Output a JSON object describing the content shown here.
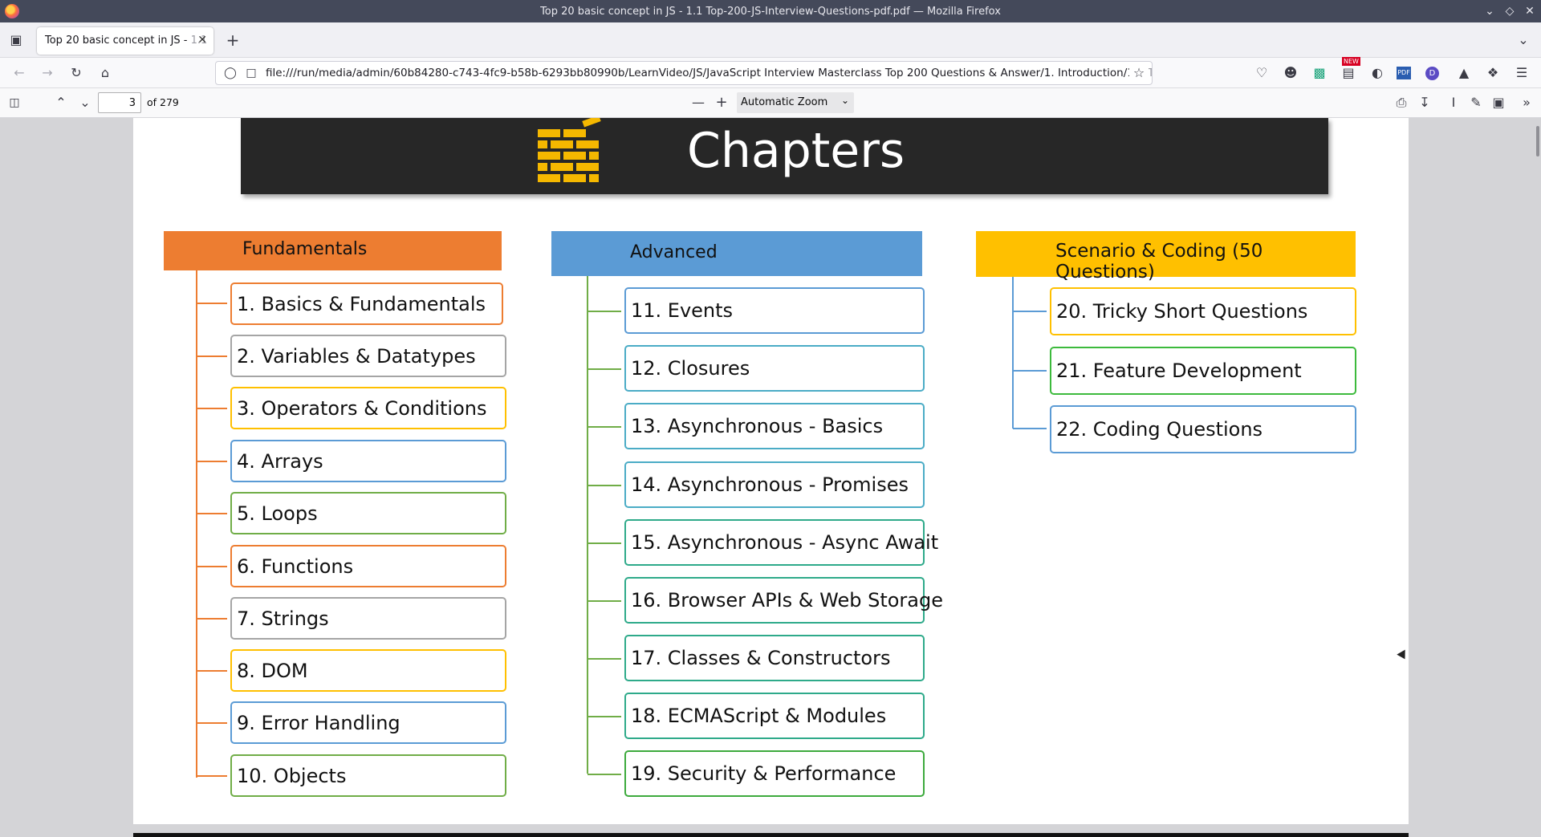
{
  "window": {
    "title": "Top 20 basic concept in JS - 1.1 Top-200-JS-Interview-Questions-pdf.pdf — Mozilla Firefox"
  },
  "tabs": [
    {
      "label": "Top 20 basic concept in JS - ",
      "label_fade": "1.1"
    }
  ],
  "nav": {
    "url": "file:///run/media/admin/60b84280-c743-4fc9-b58b-6293bb80990b/LearnVideo/JS/JavaScript Interview Masterclass Top 200 Questions & Answer/1. Introduction/1.1 ",
    "url_fade": "T"
  },
  "pdf_toolbar": {
    "page_number": "3",
    "page_count": "of 279",
    "zoom": "Automatic Zoom",
    "badge_new": "NEW",
    "badge_pdf": "PDF",
    "badge_d": "D"
  },
  "document": {
    "banner_title": "Chapters",
    "columns": [
      {
        "header": "Fundamentals",
        "header_color": "#ED7D31",
        "items": [
          {
            "label": "1. Basics & Fundamentals",
            "color": "#ED7D31"
          },
          {
            "label": "2. Variables & Datatypes",
            "color": "#A5A5A5"
          },
          {
            "label": "3. Operators & Conditions",
            "color": "#FFC000"
          },
          {
            "label": "4. Arrays",
            "color": "#5B9BD5"
          },
          {
            "label": "5. Loops",
            "color": "#70AD47"
          },
          {
            "label": "6. Functions",
            "color": "#ED7D31"
          },
          {
            "label": "7. Strings",
            "color": "#A5A5A5"
          },
          {
            "label": "8. DOM",
            "color": "#FFC000"
          },
          {
            "label": "9. Error Handling",
            "color": "#5B9BD5"
          },
          {
            "label": "10. Objects",
            "color": "#70AD47"
          }
        ]
      },
      {
        "header": "Advanced",
        "header_color": "#5B9BD5",
        "items": [
          {
            "label": "11. Events",
            "color": "#5B9BD5"
          },
          {
            "label": "12. Closures",
            "color": "#4BACC6"
          },
          {
            "label": "13. Asynchronous - Basics",
            "color": "#4BACC6"
          },
          {
            "label": "14. Asynchronous - Promises",
            "color": "#4BACC6"
          },
          {
            "label": "15. Asynchronous - Async Await",
            "color": "#2EAA8A"
          },
          {
            "label": "16. Browser APIs & Web Storage",
            "color": "#2EAA8A"
          },
          {
            "label": "17. Classes & Constructors",
            "color": "#2EAA8A"
          },
          {
            "label": "18. ECMAScript & Modules",
            "color": "#2EAA8A"
          },
          {
            "label": "19. Security & Performance",
            "color": "#3DAA3D"
          }
        ]
      },
      {
        "header": "Scenario & Coding (50 Questions)",
        "header_color": "#FFC000",
        "items": [
          {
            "label": "20. Tricky Short Questions",
            "color": "#FFC000"
          },
          {
            "label": "21. Feature Development",
            "color": "#3DBA3D"
          },
          {
            "label": "22. Coding Questions",
            "color": "#5B9BD5"
          }
        ]
      }
    ]
  }
}
